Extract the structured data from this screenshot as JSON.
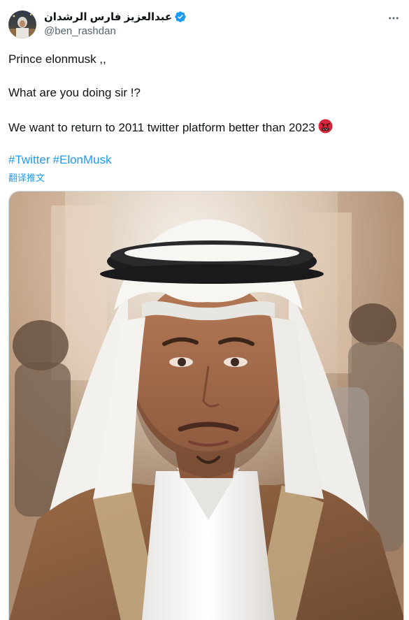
{
  "author": {
    "display_name": "عبدالعزيز فارس الرشدان",
    "handle": "@ben_rashdan",
    "verified": true,
    "avatar": "profile-avatar"
  },
  "more_icon": "more-horizontal-icon",
  "tweet": {
    "line1": "Prince elonmusk ,,",
    "line2": "What are you doing sir !?",
    "line3": "We want to return to 2011 twitter platform better than 2023",
    "line3_emoji": "angry-face-emoji",
    "hashtags": [
      "#Twitter",
      "#ElonMusk"
    ],
    "translate": "翻译推文"
  },
  "media": {
    "kind": "photo",
    "icon": "tweet-photo"
  },
  "colors": {
    "link": "#1d9bf0",
    "text": "#0f1419",
    "secondary": "#536471",
    "border": "#cfd9de"
  }
}
